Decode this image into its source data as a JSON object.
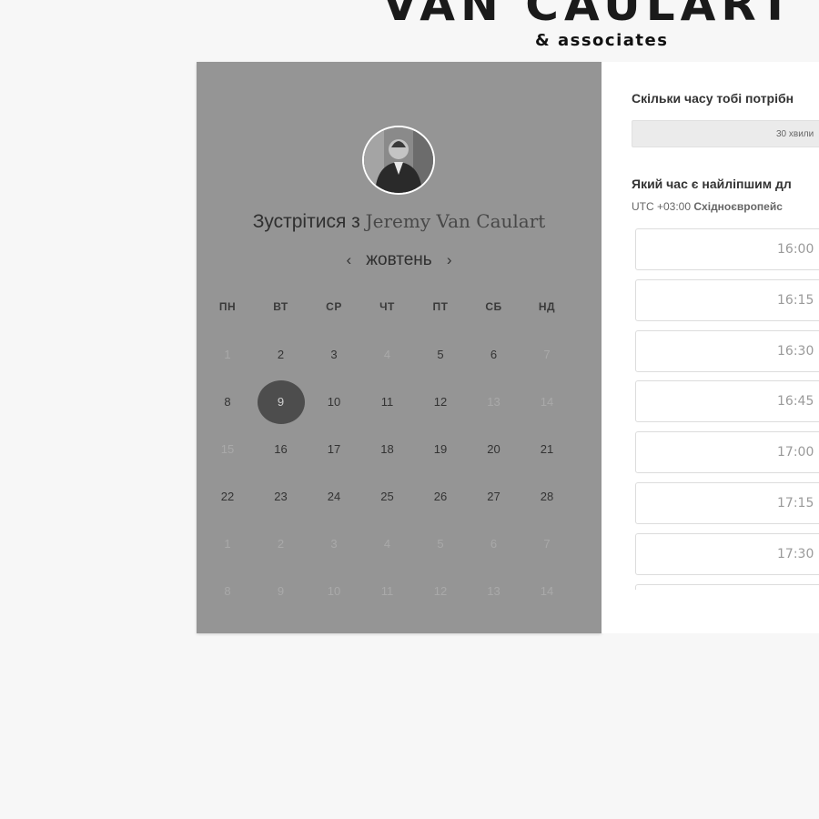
{
  "brand": {
    "title": "VAN CAULART",
    "subtitle": "& associates"
  },
  "colors": {
    "panel_gray": "#959595",
    "selected_day": "#4d4d4d",
    "background": "#f7f7f7"
  },
  "calendar": {
    "meet_prefix": "Зустрітися з",
    "meet_name": "Jeremy Van Caulart",
    "month": "жовтень",
    "prev_icon": "‹",
    "next_icon": "›",
    "weekdays": [
      "ПН",
      "ВТ",
      "СР",
      "ЧТ",
      "ПТ",
      "СБ",
      "НД"
    ],
    "selected_day": "9",
    "weeks": [
      [
        {
          "d": "1",
          "muted": true
        },
        {
          "d": "2"
        },
        {
          "d": "3"
        },
        {
          "d": "4",
          "muted": true
        },
        {
          "d": "5"
        },
        {
          "d": "6"
        },
        {
          "d": "7",
          "muted": true
        }
      ],
      [
        {
          "d": "8"
        },
        {
          "d": "9",
          "selected": true
        },
        {
          "d": "10"
        },
        {
          "d": "11"
        },
        {
          "d": "12"
        },
        {
          "d": "13",
          "muted": true
        },
        {
          "d": "14",
          "muted": true
        }
      ],
      [
        {
          "d": "15",
          "muted": true
        },
        {
          "d": "16"
        },
        {
          "d": "17"
        },
        {
          "d": "18"
        },
        {
          "d": "19"
        },
        {
          "d": "20"
        },
        {
          "d": "21"
        }
      ],
      [
        {
          "d": "22"
        },
        {
          "d": "23"
        },
        {
          "d": "24"
        },
        {
          "d": "25"
        },
        {
          "d": "26"
        },
        {
          "d": "27"
        },
        {
          "d": "28"
        }
      ],
      [
        {
          "d": "1",
          "muted": true
        },
        {
          "d": "2",
          "muted": true
        },
        {
          "d": "3",
          "muted": true
        },
        {
          "d": "4",
          "muted": true
        },
        {
          "d": "5",
          "muted": true
        },
        {
          "d": "6",
          "muted": true
        },
        {
          "d": "7",
          "muted": true
        }
      ],
      [
        {
          "d": "8",
          "muted": true
        },
        {
          "d": "9",
          "muted": true
        },
        {
          "d": "10",
          "muted": true
        },
        {
          "d": "11",
          "muted": true
        },
        {
          "d": "12",
          "muted": true
        },
        {
          "d": "13",
          "muted": true
        },
        {
          "d": "14",
          "muted": true
        }
      ]
    ]
  },
  "booking": {
    "duration_question": "Скільки часу тобі потрібн",
    "duration_value": "30 хвили",
    "time_question": "Який час є найліпшим дл",
    "tz_offset": "UTC +03:00",
    "tz_name": "Східноєвропейс",
    "slots": [
      "16:00",
      "16:15",
      "16:30",
      "16:45",
      "17:00",
      "17:15",
      "17:30",
      ""
    ]
  }
}
